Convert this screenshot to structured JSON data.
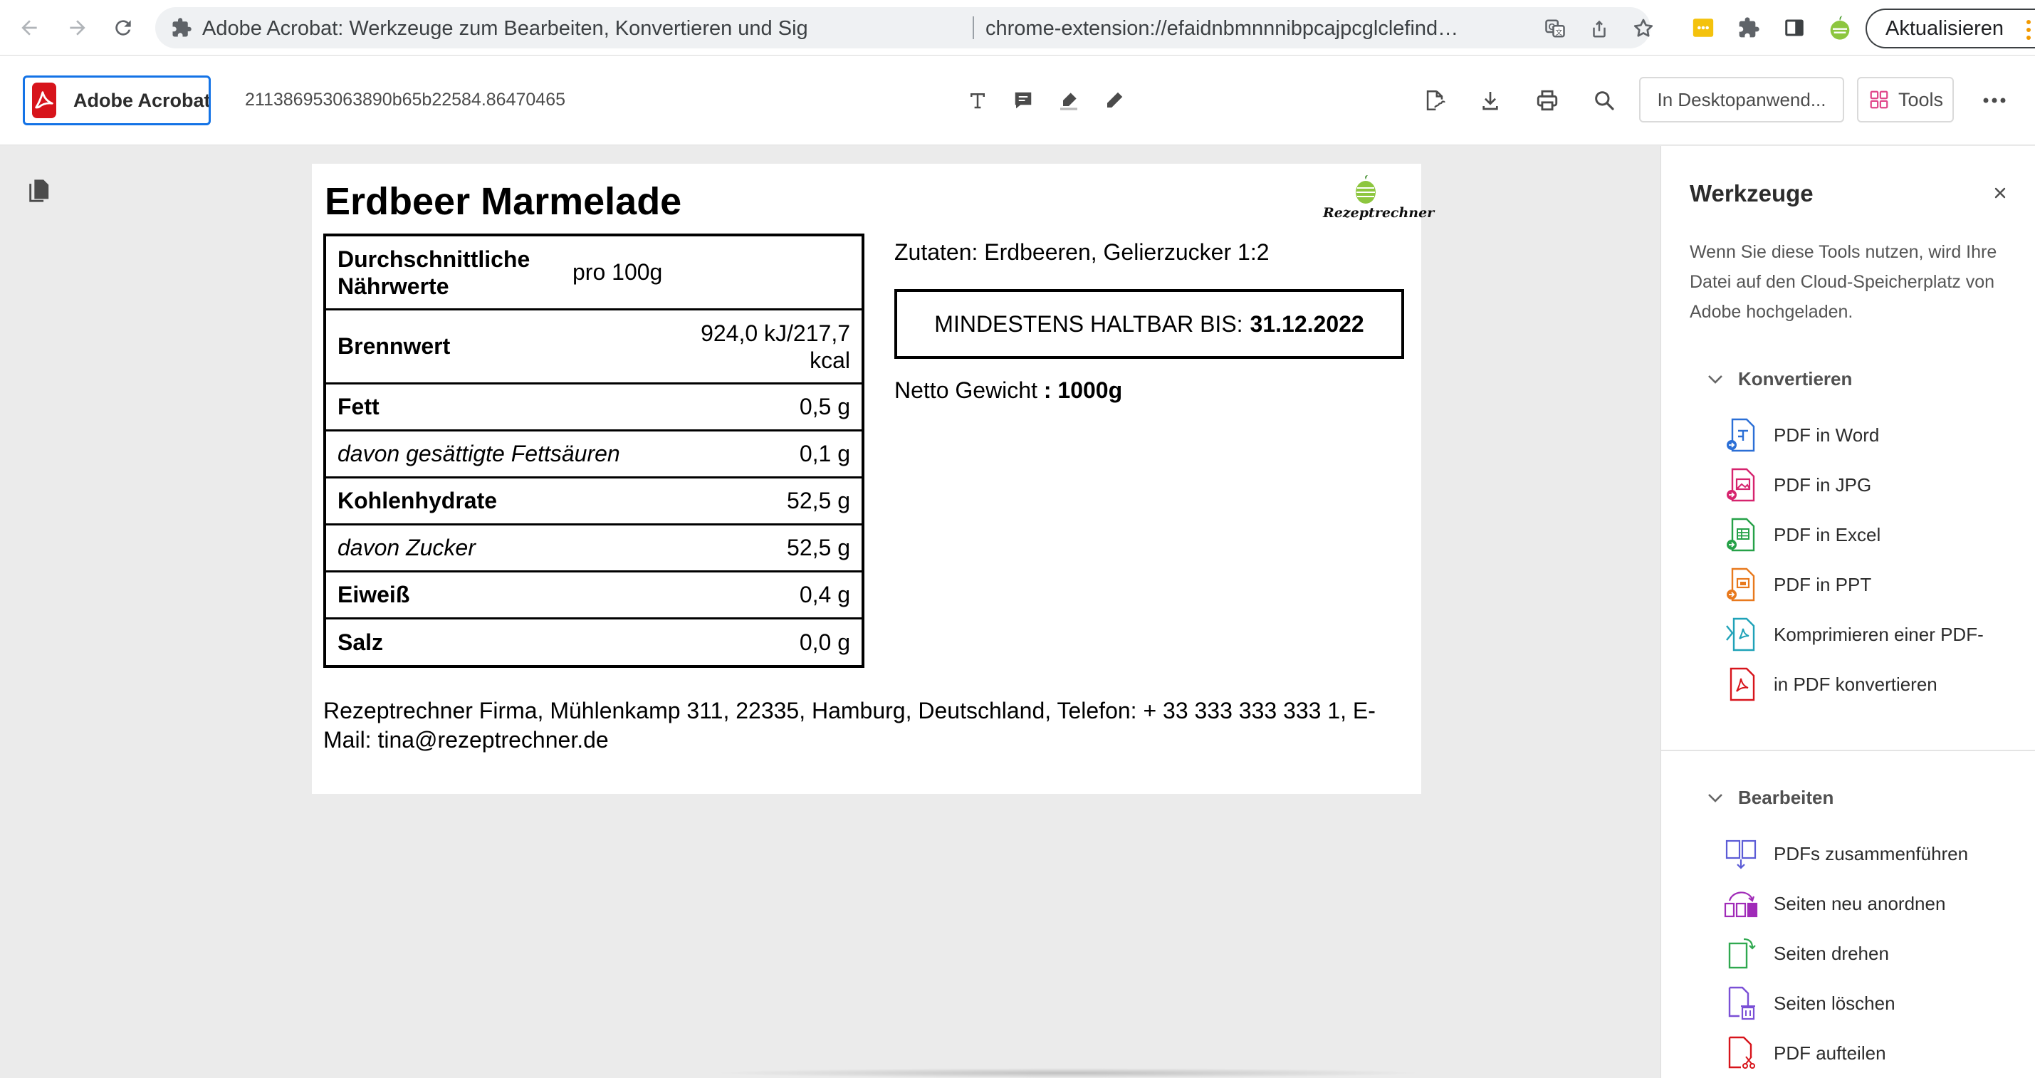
{
  "browser": {
    "tab_title": "Adobe Acrobat: Werkzeuge zum Bearbeiten, Konvertieren und Sig",
    "url": "chrome-extension://efaidnbmnnnibpcajpcglclefindmkaj/https://app.rez…",
    "update_label": "Aktualisieren",
    "icons": [
      "back-icon",
      "forward-icon",
      "reload-icon",
      "extension-icon",
      "translate-icon",
      "share-icon",
      "bookmark-star-icon",
      "extensions-puzzle-icon",
      "sidebar-icon",
      "profile-avatar-icon"
    ]
  },
  "acrobat": {
    "brand": "Adobe Acrobat",
    "doc_name": "211386953063890b65b22584.86470465",
    "desktop_button": "In Desktopanwend...",
    "tools_button": "Tools"
  },
  "document": {
    "title": "Erdbeer Marmelade",
    "logo_text": "Rezeptrechner",
    "nutrition_rows": [
      {
        "label": "Durchschnittliche Nährwerte",
        "value": "pro 100g",
        "style": "bold"
      },
      {
        "label": "Brennwert",
        "value": "924,0 kJ/217,7 kcal",
        "style": "bold"
      },
      {
        "label": "Fett",
        "value": "0,5 g",
        "style": "bold"
      },
      {
        "label": "davon gesättigte Fettsäuren",
        "value": "0,1 g",
        "style": "italic"
      },
      {
        "label": "Kohlenhydrate",
        "value": "52,5 g",
        "style": "bold"
      },
      {
        "label": "davon Zucker",
        "value": "52,5 g",
        "style": "italic"
      },
      {
        "label": "Eiweiß",
        "value": "0,4 g",
        "style": "bold"
      },
      {
        "label": "Salz",
        "value": "0,0 g",
        "style": "bold"
      }
    ],
    "ingredients": "Zutaten: Erdbeeren, Gelierzucker 1:2",
    "mhd_label": "MINDESTENS HALTBAR BIS:",
    "mhd_date": "31.12.2022",
    "netto_label": "Netto Gewicht",
    "netto_value": ": 1000g",
    "footer": "Rezeptrechner Firma, Mühlenkamp 311, 22335, Hamburg, Deutschland, Telefon: + 33 333 333 333 1, E-Mail: tina@rezeptrechner.de"
  },
  "panel": {
    "title": "Werkzeuge",
    "description": "Wenn Sie diese Tools nutzen, wird Ihre Datei auf den Cloud-Speicherplatz von Adobe hochgeladen.",
    "sections": [
      {
        "label": "Konvertieren",
        "items": [
          {
            "label": "PDF in Word",
            "icon": "pdf-to-word-icon",
            "color": "#2b6fd6"
          },
          {
            "label": "PDF in JPG",
            "icon": "pdf-to-jpg-icon",
            "color": "#d6246e"
          },
          {
            "label": "PDF in Excel",
            "icon": "pdf-to-excel-icon",
            "color": "#26a148"
          },
          {
            "label": "PDF in PPT",
            "icon": "pdf-to-ppt-icon",
            "color": "#e8791d"
          },
          {
            "label": "Komprimieren einer PDF-",
            "icon": "compress-pdf-icon",
            "color": "#1fa2b8"
          },
          {
            "label": "in PDF konvertieren",
            "icon": "convert-to-pdf-icon",
            "color": "#d7141b"
          }
        ]
      },
      {
        "label": "Bearbeiten",
        "items": [
          {
            "label": "PDFs zusammenführen",
            "icon": "merge-pdf-icon",
            "color": "#5b5bd6"
          },
          {
            "label": "Seiten neu anordnen",
            "icon": "reorder-pages-icon",
            "color": "#a02bb8"
          },
          {
            "label": "Seiten drehen",
            "icon": "rotate-pages-icon",
            "color": "#2fa84f"
          },
          {
            "label": "Seiten löschen",
            "icon": "delete-pages-icon",
            "color": "#7a4fd6"
          },
          {
            "label": "PDF aufteilen",
            "icon": "split-pdf-icon",
            "color": "#d7141b"
          }
        ]
      }
    ]
  }
}
